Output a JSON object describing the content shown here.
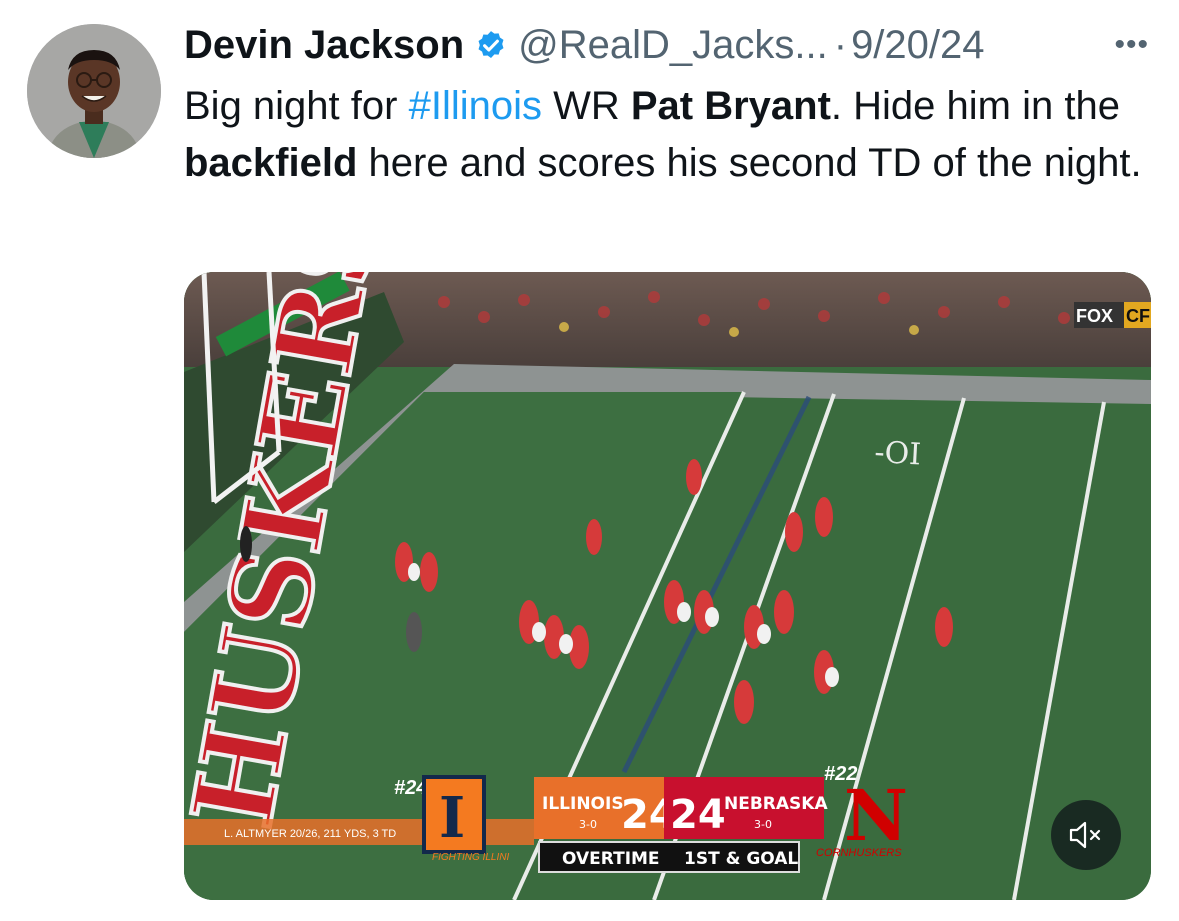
{
  "tweet": {
    "author_name": "Devin Jackson",
    "handle": "@RealD_Jacks...",
    "separator": "·",
    "date": "9/20/24",
    "more_icon": "more-icon",
    "text": {
      "t1": "Big night for ",
      "hashtag": "#Illinois",
      "t2": " WR ",
      "b1": "Pat Bryant",
      "t3": ". Hide him in the ",
      "b2": "backfield",
      "t4": " here and scores his second TD of the night."
    }
  },
  "video": {
    "field_text": "HUSKERS",
    "yard_marker": "-OI",
    "network": "FOX",
    "network_suffix": "CF",
    "left_rank": "#24",
    "right_rank": "#22",
    "player_stat": "L. ALTMYER   20/26, 211 YDS, 3 TD",
    "away_team": "ILLINOIS",
    "away_record": "3-0",
    "away_score": "24",
    "home_score": "24",
    "home_team": "NEBRASKA",
    "home_record": "3-0",
    "period": "OVERTIME",
    "down_distance": "1ST & GOAL",
    "illinois_logo_text": "I",
    "illinois_sub": "FIGHTING ILLINI",
    "nebraska_logo_text": "N",
    "nebraska_sub": "CORNHUSKERS",
    "mute_icon": "speaker-muted-icon"
  },
  "colors": {
    "link": "#1d9bf0",
    "verified": "#1d9bf0",
    "illinois_orange": "#e8702a",
    "nebraska_red": "#d00000",
    "field_green": "#3a6b3e"
  }
}
